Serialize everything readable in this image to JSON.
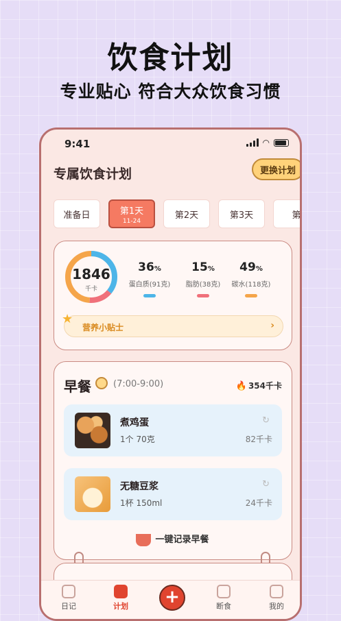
{
  "promo": {
    "headline": "饮食计划",
    "subhead": "专业贴心 符合大众饮食习惯"
  },
  "status_bar": {
    "time": "9:41"
  },
  "header": {
    "title": "专属饮食计划",
    "change_button": "更换计划"
  },
  "days": [
    {
      "label": "准备日",
      "sub": ""
    },
    {
      "label": "第1天",
      "sub": "11-24",
      "active": true
    },
    {
      "label": "第2天",
      "sub": ""
    },
    {
      "label": "第3天",
      "sub": ""
    },
    {
      "label": "第",
      "sub": ""
    }
  ],
  "nutrition": {
    "calories": "1846",
    "calories_unit": "千卡",
    "macros": [
      {
        "pct": "36",
        "label": "蛋白质(91克)",
        "color": "#4db5e8",
        "fraction": 0.36
      },
      {
        "pct": "15",
        "label": "脂肪(38克)",
        "color": "#f0707a",
        "fraction": 0.15
      },
      {
        "pct": "49",
        "label": "碳水(118克)",
        "color": "#f5a54a",
        "fraction": 0.49
      }
    ],
    "percent_sign": "%",
    "tip": "营养小贴士"
  },
  "meal": {
    "title": "早餐",
    "time": "(7:00-9:00)",
    "kcal": "354千卡",
    "foods": [
      {
        "name": "煮鸡蛋",
        "qty": "1个 70克",
        "kcal": "82千卡"
      },
      {
        "name": "无糖豆浆",
        "qty": "1杯 150ml",
        "kcal": "24千卡"
      }
    ],
    "record_button": "一键记录早餐"
  },
  "tabbar": {
    "items": [
      "日记",
      "计划",
      "断食",
      "我的"
    ],
    "add_symbol": "+"
  },
  "colors": {
    "accent": "#e0442f",
    "active_day": "#f57a62"
  }
}
